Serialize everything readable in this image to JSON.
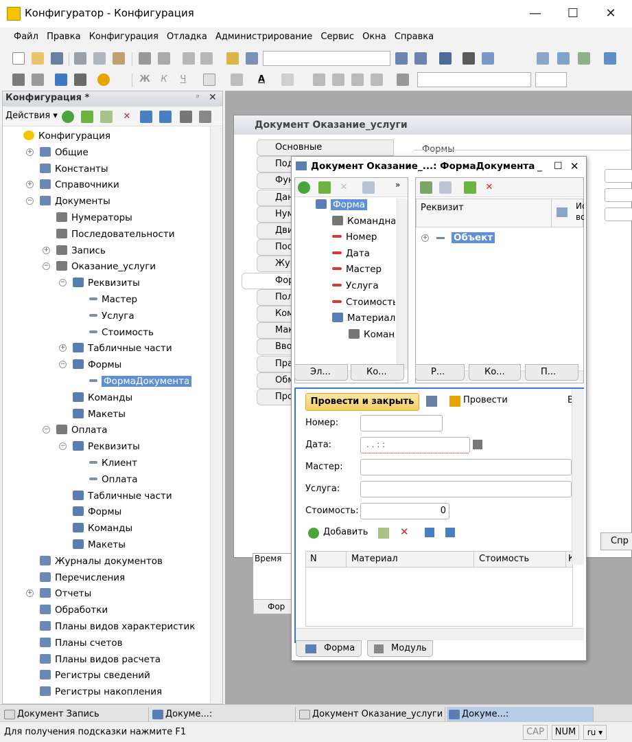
{
  "window": {
    "title": "Конфигуратор - Конфигурация",
    "min": "—",
    "max": "☐",
    "close": "✕"
  },
  "menu": [
    "Файл",
    "Правка",
    "Конфигурация",
    "Отладка",
    "Администрирование",
    "Сервис",
    "Окна",
    "Справка"
  ],
  "left_panel": {
    "title": "Конфигурация *",
    "pin": "ᵖ",
    "close": "✕",
    "actions": "Действия ▾"
  },
  "tree": [
    {
      "label": "Конфигурация",
      "indent": 0
    },
    {
      "label": "Общие",
      "indent": 1
    },
    {
      "label": "Константы",
      "indent": 1
    },
    {
      "label": "Справочники",
      "indent": 1
    },
    {
      "label": "Документы",
      "indent": 1
    },
    {
      "label": "Нумераторы",
      "indent": 2
    },
    {
      "label": "Последовательности",
      "indent": 2
    },
    {
      "label": "Запись",
      "indent": 2
    },
    {
      "label": "Оказание_услуги",
      "indent": 2
    },
    {
      "label": "Реквизиты",
      "indent": 3
    },
    {
      "label": "Мастер",
      "indent": 4
    },
    {
      "label": "Услуга",
      "indent": 4
    },
    {
      "label": "Стоимость",
      "indent": 4
    },
    {
      "label": "Табличные части",
      "indent": 3
    },
    {
      "label": "Формы",
      "indent": 3
    },
    {
      "label": "ФормаДокумента",
      "indent": 4
    },
    {
      "label": "Команды",
      "indent": 3
    },
    {
      "label": "Макеты",
      "indent": 3
    },
    {
      "label": "Оплата",
      "indent": 2
    },
    {
      "label": "Реквизиты",
      "indent": 3
    },
    {
      "label": "Клиент",
      "indent": 4
    },
    {
      "label": "Оплата",
      "indent": 4
    },
    {
      "label": "Табличные части",
      "indent": 3
    },
    {
      "label": "Формы",
      "indent": 3
    },
    {
      "label": "Команды",
      "indent": 3
    },
    {
      "label": "Макеты",
      "indent": 3
    },
    {
      "label": "Журналы документов",
      "indent": 1
    },
    {
      "label": "Перечисления",
      "indent": 1
    },
    {
      "label": "Отчеты",
      "indent": 1
    },
    {
      "label": "Обработки",
      "indent": 1
    },
    {
      "label": "Планы видов характеристик",
      "indent": 1
    },
    {
      "label": "Планы счетов",
      "indent": 1
    },
    {
      "label": "Планы видов расчета",
      "indent": 1
    },
    {
      "label": "Регистры сведений",
      "indent": 1
    },
    {
      "label": "Регистры накопления",
      "indent": 1
    }
  ],
  "doc_window": {
    "title": "Документ Оказание_услуги",
    "forms_group": "Формы",
    "tabs": [
      "Основные",
      "Под",
      "Фун",
      "Дан",
      "Нум",
      "Дви",
      "Пос",
      "Жур",
      "Фор",
      "Пол",
      "Ком",
      "Мак",
      "Вво",
      "Пра",
      "Обм",
      "Про"
    ],
    "bottom_btn": "Спр",
    "bottom_text": "Время",
    "bottom_tab": "Фор"
  },
  "form_window": {
    "title": "Документ Оказание_...: ФормаДокумента",
    "elements": [
      "Форма",
      "Командная па",
      "Номер",
      "Дата",
      "Мастер",
      "Услуга",
      "Стоимость",
      "Материалы",
      "Командна"
    ],
    "req_header": "Реквизит",
    "req_col2": "Ис во",
    "req_object": "Объект",
    "left_tabs": [
      "Эл...",
      "Ко..."
    ],
    "right_tabs": [
      "Р...",
      "Ко...",
      "П..."
    ],
    "post_close": "Провести и закрыть",
    "post": "Провести",
    "more": "В",
    "fields": {
      "number": "Номер:",
      "date": "Дата:",
      "master": "Мастер:",
      "service": "Услуга:",
      "cost": "Стоимость:"
    },
    "date_mask": ". .    : :",
    "cost_value": "0",
    "add": "Добавить",
    "grid_cols": [
      "N",
      "Материал",
      "Стоимость",
      "К"
    ],
    "bottom_tabs": [
      "Форма",
      "Модуль"
    ]
  },
  "taskbar": [
    "Документ Запись",
    "Докуме...: ФормаДокумента",
    "Документ Оказание_услуги",
    "Докуме...: ФормаДокумента"
  ],
  "status": {
    "hint": "Для получения подсказки нажмите F1",
    "cap": "CAP",
    "num": "NUM",
    "lang": "ru ▾"
  }
}
